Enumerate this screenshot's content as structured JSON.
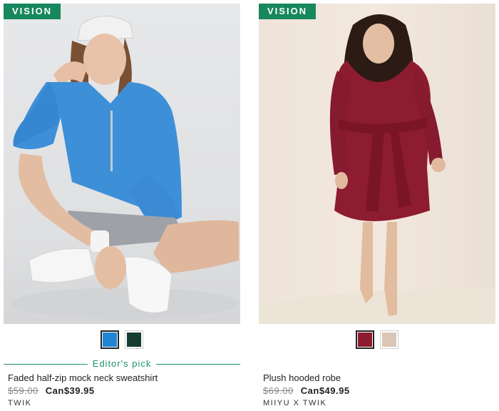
{
  "products": [
    {
      "badge": "VISION",
      "swatches": [
        {
          "color": "#1f86d4",
          "selected": true
        },
        {
          "color": "#163d32",
          "selected": false
        }
      ],
      "tag": "Editor's pick",
      "title": "Faded half-zip mock neck sweatshirt",
      "old_price": "$59.00",
      "new_price": "Can$39.95",
      "brand": "TWIK"
    },
    {
      "badge": "VISION",
      "swatches": [
        {
          "color": "#8e1a30",
          "selected": true
        },
        {
          "color": "#d9c6b4",
          "selected": false
        }
      ],
      "tag": "",
      "title": "Plush hooded robe",
      "old_price": "$69.00",
      "new_price": "Can$49.95",
      "brand": "MIIYU X TWIK"
    }
  ]
}
